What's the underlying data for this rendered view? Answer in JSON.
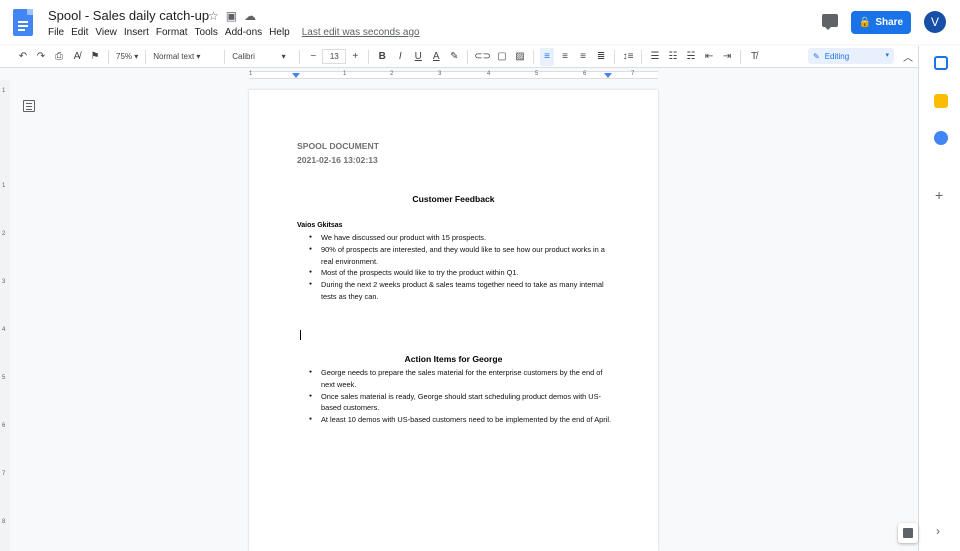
{
  "header": {
    "doc_title": "Spool - Sales daily catch-up",
    "menu": [
      "File",
      "Edit",
      "View",
      "Insert",
      "Format",
      "Tools",
      "Add-ons",
      "Help"
    ],
    "last_edit": "Last edit was seconds ago",
    "share_label": "Share",
    "avatar_initial": "V"
  },
  "toolbar": {
    "zoom": "75%",
    "style": "Normal text",
    "font": "Calibri",
    "font_size": "13",
    "mode": "Editing"
  },
  "ruler": {
    "numbers": [
      "1",
      "1",
      "2",
      "3",
      "4",
      "5",
      "6",
      "7"
    ]
  },
  "vruler": {
    "numbers": [
      "1",
      "1",
      "2",
      "3",
      "4",
      "5",
      "6",
      "7",
      "8"
    ]
  },
  "document": {
    "header_line1": "SPOOL DOCUMENT",
    "header_line2": "2021-02-16 13:02:13",
    "feedback_title": "Customer Feedback",
    "author": "Vaios Gkitsas",
    "feedback_items": [
      "We have discussed our product with 15 prospects.",
      "90% of prospects are interested, and they would like to see how our product works in a real environment.",
      "Most of the prospects would like to try the product within Q1.",
      "During the next 2 weeks product & sales teams together need to take as many internal tests as they can."
    ],
    "actions_title": "Action Items for George",
    "action_items": [
      "George needs to prepare the sales material for the enterprise customers by the end of next week.",
      "Once sales material is ready, George should start scheduling product demos with US-based customers.",
      "At least 10 demos with US-based customers need to be implemented by the end of April."
    ]
  },
  "colors": {
    "accent": "#1a73e8",
    "docs_blue": "#4285f4",
    "calendar": "#1a73e8",
    "keep": "#fbbc04",
    "tasks": "#4285f4"
  }
}
